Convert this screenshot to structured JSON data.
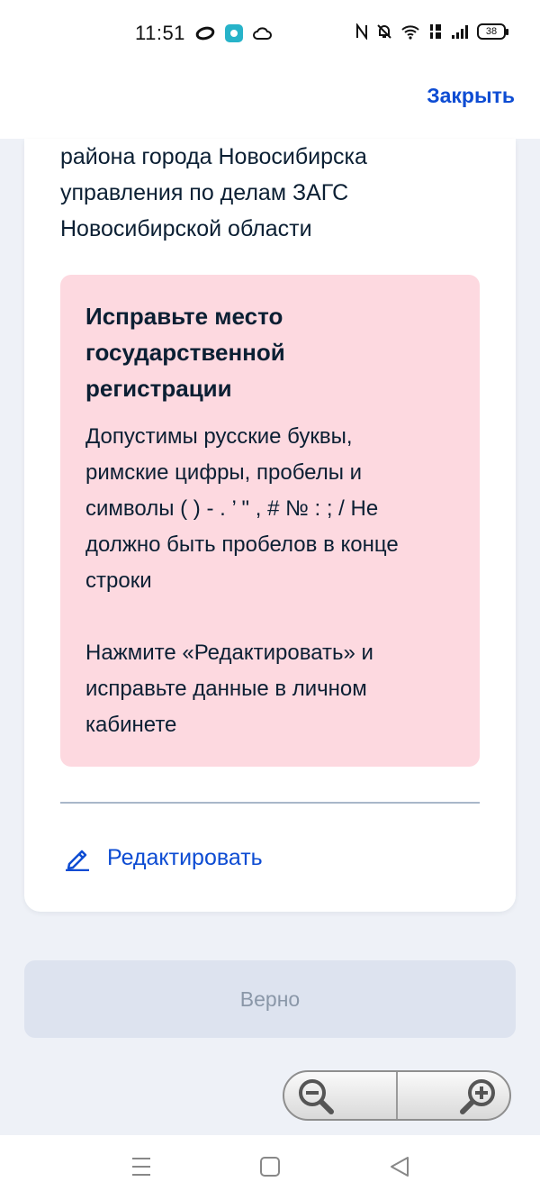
{
  "status_bar": {
    "time": "11:51",
    "battery": "38",
    "icons": [
      "infinity-icon",
      "app-badge-icon",
      "cloud-icon",
      "nfc-icon",
      "mute-icon",
      "wifi-icon",
      "volte-icon",
      "signal-icon",
      "battery-icon"
    ]
  },
  "header": {
    "close_label": "Закрыть"
  },
  "content": {
    "office_lines": [
      "района города Новосибирска",
      "управления по делам ЗАГС",
      "Новосибирской области"
    ],
    "error": {
      "title_lines": [
        "Исправьте место",
        "государственной",
        "регистрации"
      ],
      "description_lines": [
        "Допустимы русские буквы,",
        "римские цифры, пробелы и",
        "символы ( ) - . ’ \" , # № : ; / Не",
        "должно быть пробелов в конце",
        "строки"
      ],
      "hint_lines": [
        "Нажмите «Редактировать» и",
        "исправьте данные в личном",
        "кабинете"
      ]
    },
    "edit_label": "Редактировать"
  },
  "confirm_label": "Верно",
  "colors": {
    "accent": "#0d4cd3",
    "error_bg": "#fdd9e0",
    "page_bg": "#eef1f7",
    "disabled_button_bg": "#dde3ef",
    "disabled_text": "#8a97a8"
  }
}
